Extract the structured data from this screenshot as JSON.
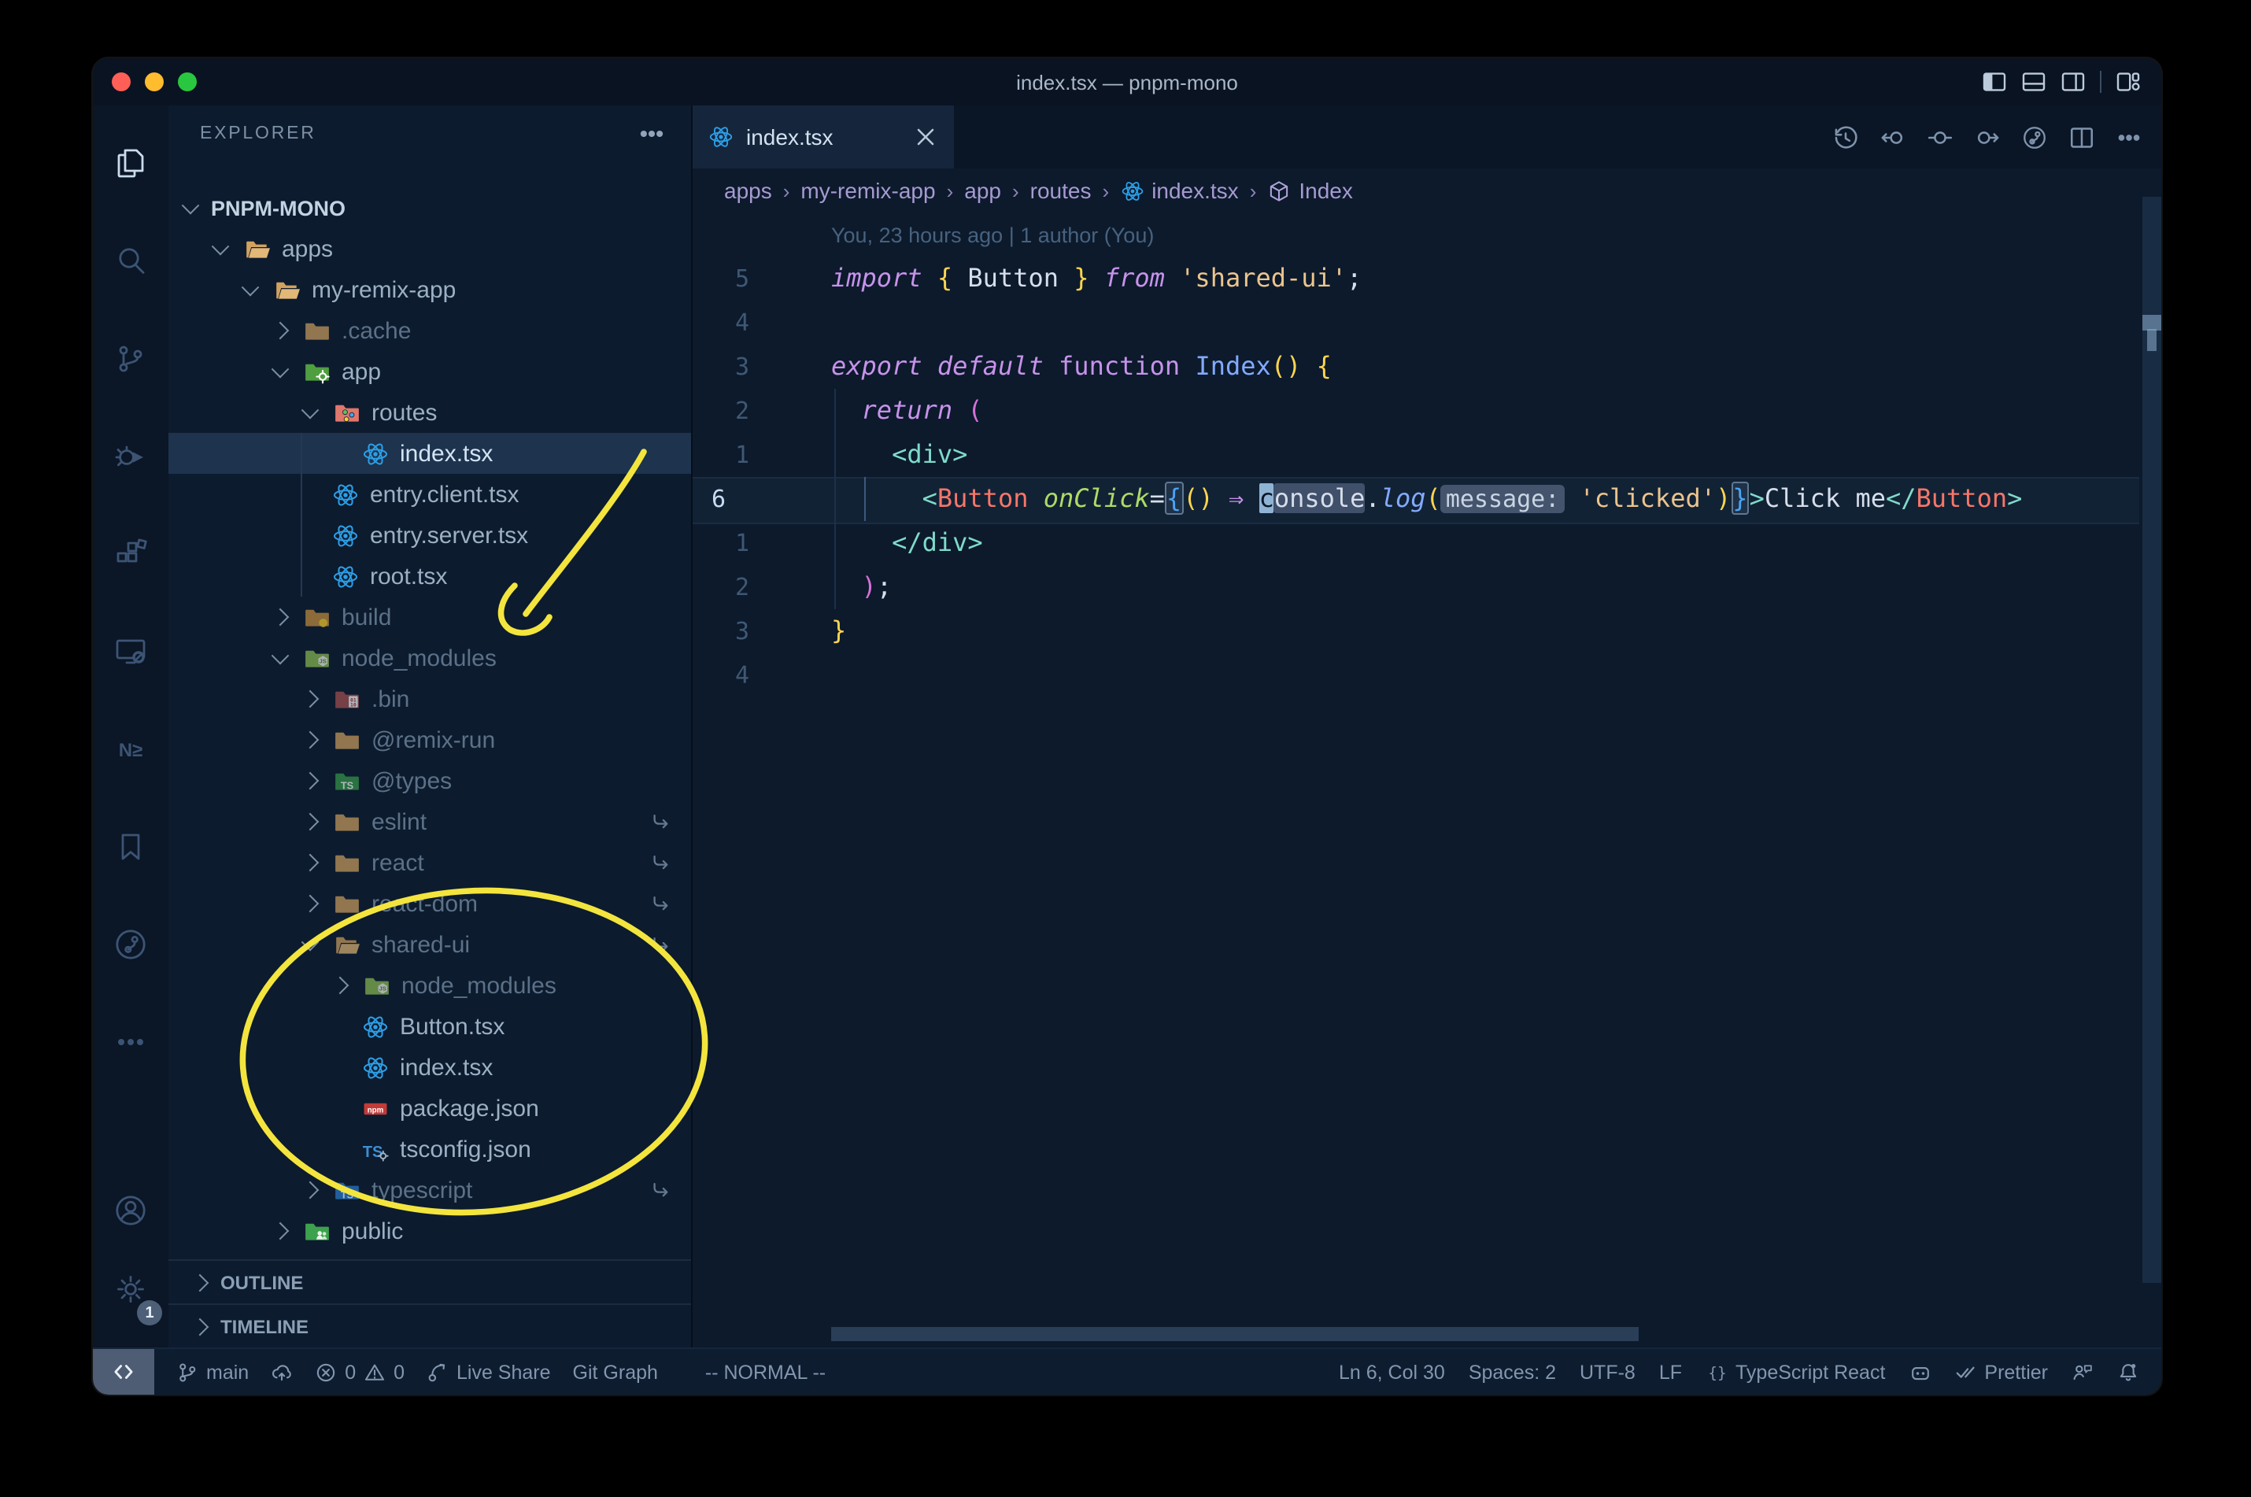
{
  "window": {
    "title": "index.tsx — pnpm-mono"
  },
  "title_bar": {
    "layout_icons": [
      "layout-sidebar-left-icon",
      "layout-panel-icon",
      "layout-sidebar-right-icon",
      "|",
      "customize-layout-icon"
    ]
  },
  "activity_bar": {
    "top": [
      {
        "name": "explorer-icon",
        "active": true
      },
      {
        "name": "search-icon"
      },
      {
        "name": "source-control-icon"
      },
      {
        "name": "run-debug-icon"
      },
      {
        "name": "extensions-icon"
      },
      {
        "name": "remote-explorer-icon"
      },
      {
        "name": "nx-console-icon"
      },
      {
        "name": "bookmarks-icon"
      },
      {
        "name": "gitlens-icon"
      },
      {
        "name": "more-views-icon"
      }
    ],
    "bottom": [
      {
        "name": "account-icon"
      },
      {
        "name": "settings-gear-icon",
        "badge": "1"
      }
    ]
  },
  "sidebar": {
    "header": "EXPLORER",
    "tree": [
      {
        "label": "PNPM-MONO",
        "depth": 0,
        "chev": "open",
        "icon": "",
        "cls": "root"
      },
      {
        "label": "apps",
        "depth": 1,
        "chev": "open",
        "icon": "folder-open-tan"
      },
      {
        "label": "my-remix-app",
        "depth": 2,
        "chev": "open",
        "icon": "folder-open-tan"
      },
      {
        "label": ".cache",
        "depth": 3,
        "chev": "closed",
        "icon": "folder-tan",
        "dim": true
      },
      {
        "label": "app",
        "depth": 3,
        "chev": "open",
        "icon": "folder-app"
      },
      {
        "label": "routes",
        "depth": 4,
        "chev": "open",
        "icon": "folder-routes"
      },
      {
        "label": "index.tsx",
        "depth": 5,
        "chev": "none",
        "icon": "react-icon",
        "selected": true
      },
      {
        "label": "entry.client.tsx",
        "depth": 4,
        "chev": "none",
        "icon": "react-icon"
      },
      {
        "label": "entry.server.tsx",
        "depth": 4,
        "chev": "none",
        "icon": "react-icon"
      },
      {
        "label": "root.tsx",
        "depth": 4,
        "chev": "none",
        "icon": "react-icon"
      },
      {
        "label": "build",
        "depth": 3,
        "chev": "closed",
        "icon": "folder-dist",
        "dim": true
      },
      {
        "label": "node_modules",
        "depth": 3,
        "chev": "open",
        "icon": "folder-node-modules",
        "dim": true
      },
      {
        "label": ".bin",
        "depth": 4,
        "chev": "closed",
        "icon": "folder-binary",
        "dim": true
      },
      {
        "label": "@remix-run",
        "depth": 4,
        "chev": "closed",
        "icon": "folder-tan",
        "dim": true
      },
      {
        "label": "@types",
        "depth": 4,
        "chev": "closed",
        "icon": "folder-types-green",
        "dim": true
      },
      {
        "label": "eslint",
        "depth": 4,
        "chev": "closed",
        "icon": "folder-tan",
        "dim": true,
        "symlink": true
      },
      {
        "label": "react",
        "depth": 4,
        "chev": "closed",
        "icon": "folder-tan",
        "dim": true,
        "symlink": true
      },
      {
        "label": "react-dom",
        "depth": 4,
        "chev": "closed",
        "icon": "folder-tan",
        "dim": true,
        "symlink": true
      },
      {
        "label": "shared-ui",
        "depth": 4,
        "chev": "open",
        "icon": "folder-open-tan",
        "dim": true,
        "symlink": true
      },
      {
        "label": "node_modules",
        "depth": 5,
        "chev": "closed",
        "icon": "folder-node-modules",
        "dim": true
      },
      {
        "label": "Button.tsx",
        "depth": 5,
        "chev": "none",
        "icon": "react-icon"
      },
      {
        "label": "index.tsx",
        "depth": 5,
        "chev": "none",
        "icon": "react-icon"
      },
      {
        "label": "package.json",
        "depth": 5,
        "chev": "none",
        "icon": "npm-icon"
      },
      {
        "label": "tsconfig.json",
        "depth": 5,
        "chev": "none",
        "icon": "tsconfig-icon"
      },
      {
        "label": "typescript",
        "depth": 4,
        "chev": "closed",
        "icon": "folder-ts-blue",
        "dim": true,
        "symlink": true
      },
      {
        "label": "public",
        "depth": 3,
        "chev": "closed",
        "icon": "folder-public"
      }
    ],
    "sections": [
      {
        "label": "OUTLINE"
      },
      {
        "label": "TIMELINE"
      }
    ]
  },
  "editor": {
    "tab": {
      "label": "index.tsx",
      "icon": "react-icon",
      "close": "✕"
    },
    "actions": [
      "timeline-icon",
      "navigate-back-icon",
      "current-change-icon",
      "navigate-forward-icon",
      "gitlens-graph-icon",
      "split-editor-icon",
      "more-actions-icon"
    ],
    "breadcrumbs": [
      {
        "label": "apps"
      },
      {
        "label": "my-remix-app"
      },
      {
        "label": "app"
      },
      {
        "label": "routes"
      },
      {
        "label": "index.tsx",
        "icon": "react-icon"
      },
      {
        "label": "Index",
        "icon": "symbol-module-icon"
      }
    ],
    "code": {
      "lines": [
        {
          "num": "",
          "tokens": [
            {
              "t": "You, 23 hours ago | 1 author (You)",
              "c": "blame"
            }
          ]
        },
        {
          "num": "5",
          "tokens": [
            {
              "t": "import ",
              "c": "kw"
            },
            {
              "t": "{ ",
              "c": "b1"
            },
            {
              "t": "Button",
              "c": "txt"
            },
            {
              "t": " }",
              "c": "b1"
            },
            {
              "t": " ",
              "c": "txt"
            },
            {
              "t": "from",
              "c": "kw"
            },
            {
              "t": " ",
              "c": "txt"
            },
            {
              "t": "'shared-ui'",
              "c": "str"
            },
            {
              "t": ";",
              "c": "txt"
            }
          ]
        },
        {
          "num": "4",
          "tokens": []
        },
        {
          "num": "3",
          "tokens": [
            {
              "t": "export",
              "c": "kw"
            },
            {
              "t": " ",
              "c": "txt"
            },
            {
              "t": "default",
              "c": "kw"
            },
            {
              "t": " ",
              "c": "txt"
            },
            {
              "t": "function",
              "c": "kwu"
            },
            {
              "t": " ",
              "c": "txt"
            },
            {
              "t": "Index",
              "c": "fn2"
            },
            {
              "t": "()",
              "c": "b1"
            },
            {
              "t": " ",
              "c": "txt"
            },
            {
              "t": "{",
              "c": "b1"
            }
          ]
        },
        {
          "num": "2",
          "tokens": [
            {
              "t": "  ",
              "c": "txt"
            },
            {
              "t": "return",
              "c": "kw"
            },
            {
              "t": " ",
              "c": "txt"
            },
            {
              "t": "(",
              "c": "b2"
            }
          ]
        },
        {
          "num": "1",
          "tokens": [
            {
              "t": "    ",
              "c": "txt"
            },
            {
              "t": "<div>",
              "c": "tag"
            }
          ]
        },
        {
          "num": "6",
          "current": true,
          "tokens": [
            {
              "t": "      ",
              "c": "txt"
            },
            {
              "t": "<",
              "c": "tag"
            },
            {
              "t": "Button",
              "c": "cmp"
            },
            {
              "t": " ",
              "c": "txt"
            },
            {
              "t": "onClick",
              "c": "attr"
            },
            {
              "t": "=",
              "c": "txt"
            },
            {
              "t": "{",
              "c": "b3x"
            },
            {
              "t": "()",
              "c": "b1"
            },
            {
              "t": " ",
              "c": "txt"
            },
            {
              "t": "⇒",
              "c": "op"
            },
            {
              "t": " ",
              "c": "txt"
            },
            {
              "t": "c",
              "c": "cursor"
            },
            {
              "t": "onsole",
              "c": "hl"
            },
            {
              "t": ".",
              "c": "txt"
            },
            {
              "t": "log",
              "c": "fn"
            },
            {
              "t": "(",
              "c": "b1"
            },
            {
              "t": "message:",
              "c": "inlay"
            },
            {
              "t": " ",
              "c": "txt"
            },
            {
              "t": "'clicked'",
              "c": "str"
            },
            {
              "t": ")",
              "c": "b1"
            },
            {
              "t": "}",
              "c": "b3x"
            },
            {
              "t": ">",
              "c": "tag"
            },
            {
              "t": "Click me",
              "c": "txt"
            },
            {
              "t": "</",
              "c": "tag"
            },
            {
              "t": "Button",
              "c": "cmp"
            },
            {
              "t": ">",
              "c": "tag"
            }
          ]
        },
        {
          "num": "1",
          "tokens": [
            {
              "t": "    ",
              "c": "txt"
            },
            {
              "t": "</div>",
              "c": "tag"
            }
          ]
        },
        {
          "num": "2",
          "tokens": [
            {
              "t": "  ",
              "c": "txt"
            },
            {
              "t": ")",
              "c": "b2"
            },
            {
              "t": ";",
              "c": "txt"
            }
          ]
        },
        {
          "num": "3",
          "tokens": [
            {
              "t": "}",
              "c": "b1"
            }
          ]
        },
        {
          "num": "4",
          "tokens": []
        }
      ]
    }
  },
  "status_bar": {
    "remote": {
      "name": "remote-indicator",
      "icon": "remote-icon"
    },
    "left": [
      {
        "name": "branch-status",
        "parts": [
          {
            "icon": "branch-icon"
          },
          {
            "text": "main"
          }
        ]
      },
      {
        "name": "publish-changes",
        "parts": [
          {
            "icon": "cloud-upload-icon"
          }
        ]
      },
      {
        "name": "problems",
        "parts": [
          {
            "icon": "error-icon"
          },
          {
            "text": "0"
          },
          {
            "icon": "warning-icon"
          },
          {
            "text": "0"
          }
        ]
      },
      {
        "name": "live-share",
        "parts": [
          {
            "icon": "live-share-icon"
          },
          {
            "text": "Live Share"
          }
        ]
      },
      {
        "name": "git-graph",
        "parts": [
          {
            "text": "Git Graph"
          }
        ]
      },
      {
        "name": "vim-mode",
        "cls": "vim",
        "parts": [
          {
            "text": "-- NORMAL --"
          }
        ]
      }
    ],
    "right": [
      {
        "name": "cursor-position",
        "parts": [
          {
            "text": "Ln 6, Col 30"
          }
        ]
      },
      {
        "name": "indentation",
        "parts": [
          {
            "text": "Spaces: 2"
          }
        ]
      },
      {
        "name": "encoding",
        "parts": [
          {
            "text": "UTF-8"
          }
        ]
      },
      {
        "name": "eol",
        "parts": [
          {
            "text": "LF"
          }
        ]
      },
      {
        "name": "language-mode",
        "parts": [
          {
            "icon": "braces-icon"
          },
          {
            "text": "TypeScript React"
          }
        ]
      },
      {
        "name": "copilot-status",
        "parts": [
          {
            "icon": "copilot-icon"
          }
        ]
      },
      {
        "name": "prettier-status",
        "parts": [
          {
            "icon": "prettier-check-icon"
          },
          {
            "text": "Prettier"
          }
        ]
      },
      {
        "name": "feedback",
        "parts": [
          {
            "icon": "feedback-icon"
          }
        ]
      },
      {
        "name": "notifications",
        "parts": [
          {
            "icon": "bell-icon"
          }
        ]
      }
    ]
  },
  "annotations": {
    "color": "#f3e53d"
  }
}
